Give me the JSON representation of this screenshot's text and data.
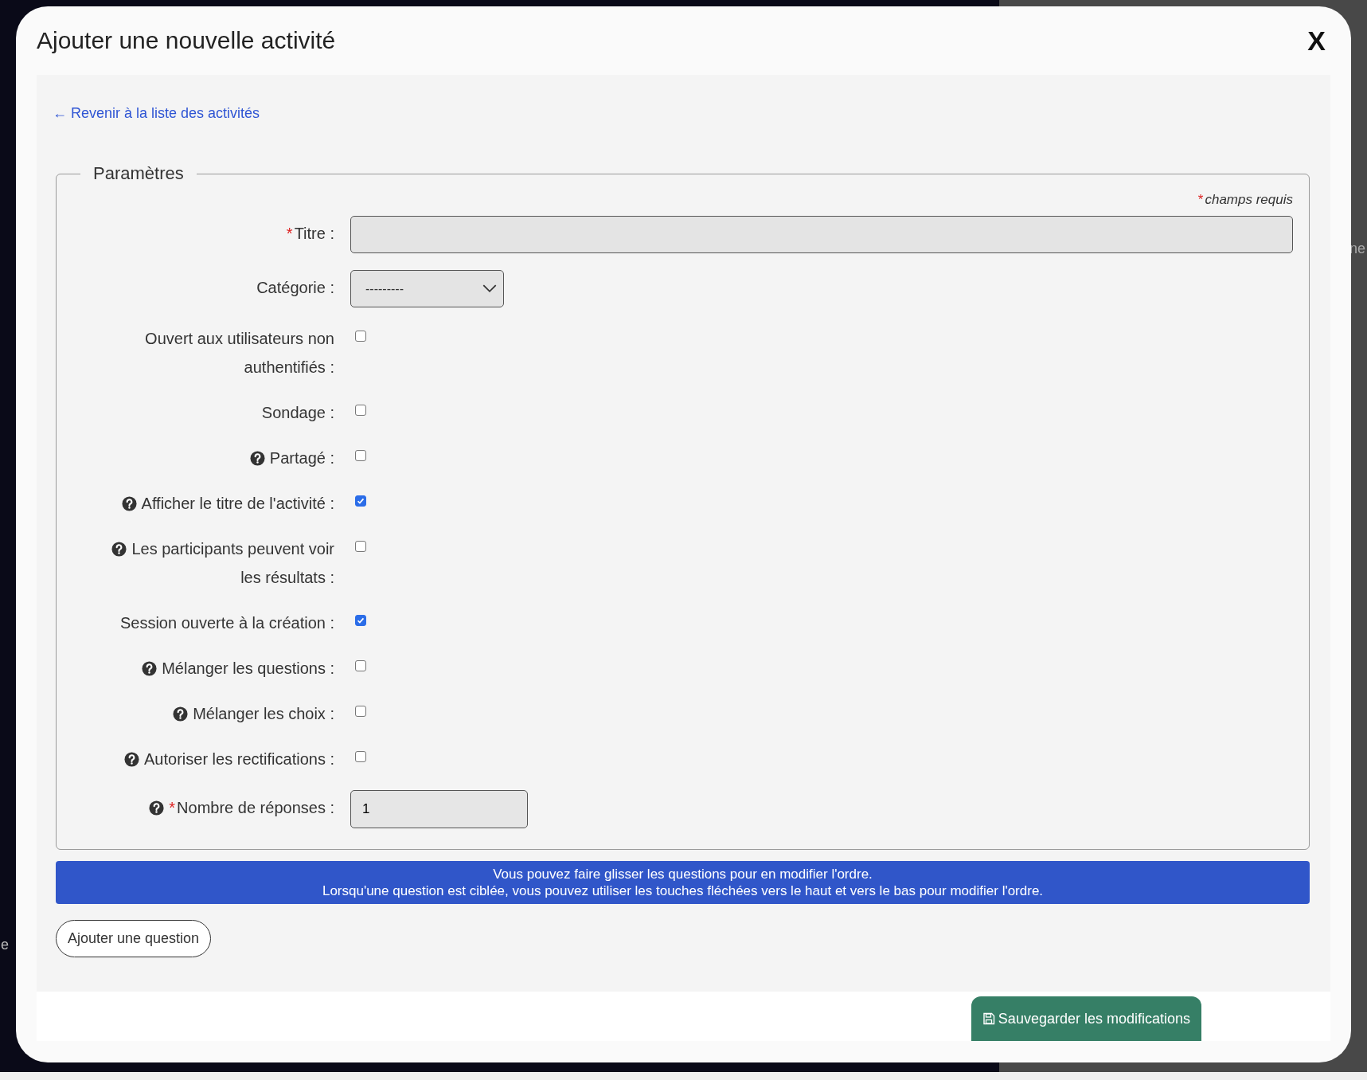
{
  "backdrop": {
    "texts": [
      "ne",
      "e"
    ]
  },
  "dialog": {
    "title": "Ajouter une nouvelle activité",
    "close": "X"
  },
  "back_link": "← Revenir à la liste des activités",
  "fieldset": {
    "legend": "Paramètres",
    "required_mark": "*",
    "required_note": "champs requis",
    "fields": [
      {
        "kind": "text",
        "label": [
          "Titre :"
        ],
        "required": true,
        "help": false
      },
      {
        "kind": "select",
        "label": [
          "Catégorie :"
        ],
        "required": false,
        "help": false,
        "value": "---------"
      },
      {
        "kind": "checkbox",
        "label": [
          "Ouvert aux utilisateurs non",
          "authentifiés :"
        ],
        "required": false,
        "help": false,
        "checked": false
      },
      {
        "kind": "checkbox",
        "label": [
          "Sondage :"
        ],
        "required": false,
        "help": false,
        "checked": false
      },
      {
        "kind": "checkbox",
        "label": [
          "Partagé :"
        ],
        "required": false,
        "help": true,
        "checked": false
      },
      {
        "kind": "checkbox",
        "label": [
          "Afficher le titre de l'activité :"
        ],
        "required": false,
        "help": true,
        "checked": true
      },
      {
        "kind": "checkbox",
        "label": [
          "Les participants peuvent voir",
          "les résultats :"
        ],
        "required": false,
        "help": true,
        "checked": false
      },
      {
        "kind": "checkbox",
        "label": [
          "Session ouverte à la création :"
        ],
        "required": false,
        "help": false,
        "checked": true
      },
      {
        "kind": "checkbox",
        "label": [
          "Mélanger les questions :"
        ],
        "required": false,
        "help": true,
        "checked": false
      },
      {
        "kind": "checkbox",
        "label": [
          "Mélanger les choix :"
        ],
        "required": false,
        "help": true,
        "checked": false
      },
      {
        "kind": "checkbox",
        "label": [
          "Autoriser les rectifications :"
        ],
        "required": false,
        "help": true,
        "checked": false
      },
      {
        "kind": "number",
        "label": [
          "Nombre de réponses :"
        ],
        "required": true,
        "help": true,
        "value": "1"
      }
    ]
  },
  "info_banner": [
    "Vous pouvez faire glisser les questions pour en modifier l'ordre.",
    "Lorsqu'une question est ciblée, vous pouvez utiliser les touches fléchées vers le haut et vers le bas pour modifier l'ordre."
  ],
  "add_question_button": "Ajouter une question",
  "save_button": "Sauvegarder les modifications"
}
